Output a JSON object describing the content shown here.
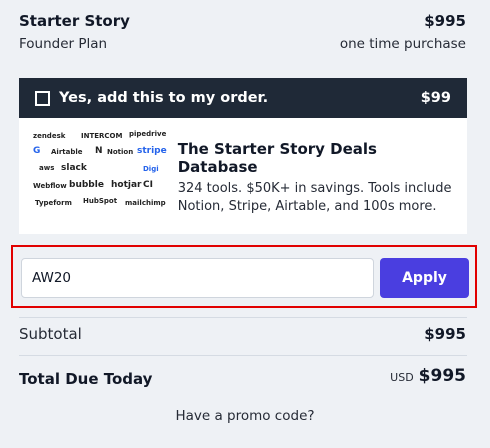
{
  "plan": {
    "title": "Starter Story",
    "price": "$995",
    "subtitle": "Founder Plan",
    "billing": "one time purchase"
  },
  "upsell": {
    "label": "Yes, add this to my order.",
    "price": "$99",
    "checked": false,
    "title": "The Starter Story Deals Database",
    "description": "324 tools. $50K+ in savings. Tools include Notion, Stripe, Airtable, and 100s more.",
    "logos": [
      "zendesk",
      "INTERCOM",
      "pipedrive",
      "G",
      "Airtable",
      "N",
      "Notion",
      "stripe",
      "aws",
      "slack",
      "Digi",
      "Webflow",
      "bubble",
      "hotjar",
      "CI",
      "Typeform",
      "HubSpot",
      "mailchimp"
    ]
  },
  "promo": {
    "code_value": "AW20",
    "apply_label": "Apply"
  },
  "summary": {
    "subtotal_label": "Subtotal",
    "subtotal_value": "$995",
    "total_label": "Total Due Today",
    "currency": "USD",
    "total_value": "$995"
  },
  "promo_link": "Have a promo code?"
}
